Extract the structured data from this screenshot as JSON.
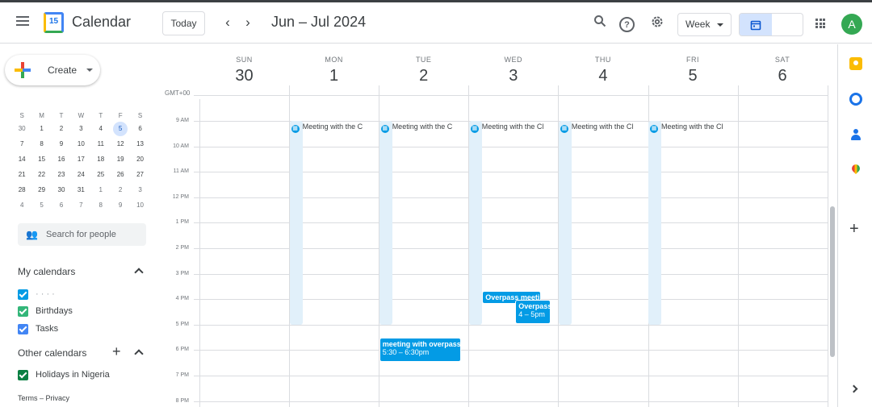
{
  "header": {
    "app_title": "Calendar",
    "logo_day": "15",
    "today_label": "Today",
    "date_range": "Jun – Jul 2024",
    "view_label": "Week",
    "avatar_initial": "A"
  },
  "sidebar": {
    "create_label": "Create",
    "mini_calendar": {
      "weekdays": [
        "S",
        "M",
        "T",
        "W",
        "T",
        "F",
        "S"
      ],
      "weeks": [
        [
          "30",
          "1",
          "2",
          "3",
          "4",
          "5",
          "6"
        ],
        [
          "7",
          "8",
          "9",
          "10",
          "11",
          "12",
          "13"
        ],
        [
          "14",
          "15",
          "16",
          "17",
          "18",
          "19",
          "20"
        ],
        [
          "21",
          "22",
          "23",
          "24",
          "25",
          "26",
          "27"
        ],
        [
          "28",
          "29",
          "30",
          "31",
          "1",
          "2",
          "3"
        ],
        [
          "4",
          "5",
          "6",
          "7",
          "8",
          "9",
          "10"
        ]
      ],
      "selected_day": "5"
    },
    "search_people_placeholder": "Search for people",
    "my_calendars_title": "My calendars",
    "my_calendars": [
      {
        "label": "· · · ·",
        "color": "#039be5"
      },
      {
        "label": "Birthdays",
        "color": "#33b679"
      },
      {
        "label": "Tasks",
        "color": "#4285f4"
      }
    ],
    "other_calendars_title": "Other calendars",
    "other_calendars": [
      {
        "label": "Holidays in Nigeria",
        "color": "#0b8043"
      }
    ],
    "footer": "Terms – Privacy"
  },
  "week": {
    "timezone": "GMT+00",
    "days": [
      {
        "dow": "SUN",
        "num": "30"
      },
      {
        "dow": "MON",
        "num": "1"
      },
      {
        "dow": "TUE",
        "num": "2"
      },
      {
        "dow": "WED",
        "num": "3"
      },
      {
        "dow": "THU",
        "num": "4"
      },
      {
        "dow": "FRI",
        "num": "5"
      },
      {
        "dow": "SAT",
        "num": "6"
      }
    ],
    "hours": [
      "9 AM",
      "10 AM",
      "11 AM",
      "12 PM",
      "1 PM",
      "2 PM",
      "3 PM",
      "4 PM",
      "5 PM",
      "6 PM",
      "7 PM",
      "8 PM"
    ]
  },
  "events": [
    {
      "day": 1,
      "title": "Meeting with the C",
      "start": 9,
      "end": 17
    },
    {
      "day": 2,
      "title": "Meeting with the C",
      "start": 9,
      "end": 17
    },
    {
      "day": 3,
      "title": "Meeting with the Cl",
      "start": 9,
      "end": 17
    },
    {
      "day": 4,
      "title": "Meeting with the Cl",
      "start": 9,
      "end": 17
    },
    {
      "day": 5,
      "title": "Meeting with the Cl",
      "start": 9,
      "end": 17
    },
    {
      "day": 3,
      "title": "Overpass meeti",
      "time": "",
      "start": 15.75,
      "end": 16.1
    },
    {
      "day": 3,
      "title": "Overpass",
      "time": "4 – 5pm",
      "start": 16,
      "end": 16.95
    },
    {
      "day": 2,
      "title": "meeting with overpass",
      "time": "5:30 – 6:30pm",
      "start": 17.5,
      "end": 18.45
    }
  ],
  "colors": {
    "accent": "#1a73e8",
    "event_light": "#e1f0fa",
    "event_dark": "#039be5"
  },
  "rail_icons": [
    "keep-icon",
    "tasks-icon",
    "contacts-icon",
    "maps-icon"
  ]
}
